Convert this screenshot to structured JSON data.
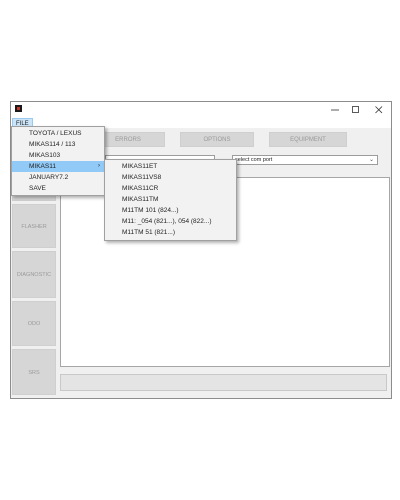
{
  "menubar": {
    "file_label": "FILE"
  },
  "window_controls": {
    "minimize": "—",
    "maximize": "☐",
    "close": "✕"
  },
  "toolbar": {
    "errors": "ERRORS",
    "options": "OPTIONS",
    "equipment": "EQUIPMENT"
  },
  "selects": {
    "ecu_value": "...",
    "com_port_value": "select com port"
  },
  "sidebar": [
    {
      "label": "FLASHER"
    },
    {
      "label": "DIAGNOSTIC"
    },
    {
      "label": "ODO"
    },
    {
      "label": "SRS"
    }
  ],
  "file_menu": {
    "items": [
      {
        "label": "TOYOTA / LEXUS"
      },
      {
        "label": "MIKAS114 / 113"
      },
      {
        "label": "MIKAS103"
      },
      {
        "label": "MIKAS11",
        "highlighted": true,
        "has_submenu": true
      },
      {
        "label": "JANUARY7.2"
      },
      {
        "label": "SAVE"
      }
    ]
  },
  "submenu": {
    "items": [
      {
        "label": "MIKAS11ET"
      },
      {
        "label": "MIKAS11VS8"
      },
      {
        "label": "MIKAS11CR"
      },
      {
        "label": "MIKAS11TM"
      },
      {
        "label": "M11TM 101 (824...)"
      },
      {
        "label": "M11: _054 (821...), 054 (822...)"
      },
      {
        "label": "M11TM 51 (821...)"
      }
    ]
  }
}
